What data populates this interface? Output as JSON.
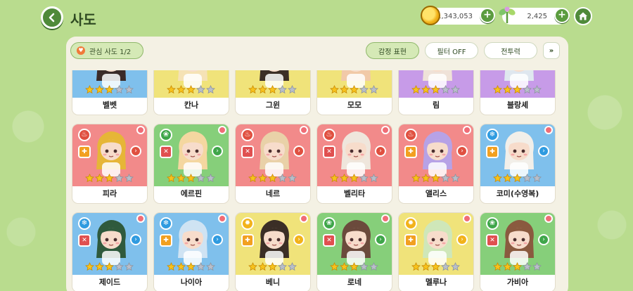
{
  "header": {
    "title": "사도",
    "gold": "1,343,053",
    "leaf": "2,425"
  },
  "filters": {
    "favorites": "관심 사도  1/2",
    "emotion": "감정 표현",
    "filter": "필터 OFF",
    "power": "전투력",
    "more": "»"
  },
  "colors": {
    "accent_green": "#5b9c3f",
    "bg_green": "#b9dc8e",
    "panel": "#f4f1e4"
  },
  "cards": [
    {
      "name": "벨벳",
      "bg": "#7fc0ec",
      "element": "water",
      "elemColor": "#2f9be0",
      "role": "shield",
      "roleColor": "#2f9be0",
      "stars": 3,
      "hair": "#3a2a28",
      "skin": "#f7dccb"
    },
    {
      "name": "칸나",
      "bg": "#f0e37a",
      "element": "light",
      "elemColor": "#f2b21a",
      "role": "sword",
      "roleColor": "#e05050",
      "stars": 3,
      "hair": "#f5e2b5",
      "skin": "#f7dccb"
    },
    {
      "name": "그윈",
      "bg": "#f0e37a",
      "element": "light",
      "elemColor": "#f2b21a",
      "role": "plus",
      "roleColor": "#f2a020",
      "stars": 3,
      "hair": "#3b2e26",
      "skin": "#f7dccb"
    },
    {
      "name": "모모",
      "bg": "#f0e37a",
      "element": "light",
      "elemColor": "#f2b21a",
      "role": "sword",
      "roleColor": "#e05050",
      "stars": 3,
      "hair": "#f1c9a8",
      "skin": "#f7dccb"
    },
    {
      "name": "림",
      "bg": "#c79be8",
      "element": "dark",
      "elemColor": "#8d50d0",
      "role": "sword",
      "roleColor": "#e05050",
      "stars": 3,
      "hair": "#efe2d8",
      "skin": "#f7dccb"
    },
    {
      "name": "블랑셰",
      "bg": "#c79be8",
      "element": "dark",
      "elemColor": "#8d50d0",
      "role": "plus",
      "roleColor": "#f2a020",
      "stars": 3,
      "hair": "#dfe7ef",
      "skin": "#f7dccb"
    },
    {
      "name": "피라",
      "bg": "#f28a8a",
      "element": "fire",
      "elemColor": "#e05040",
      "role": "plus",
      "roleColor": "#f2a020",
      "stars": 3,
      "hair": "#e6b637",
      "skin": "#f7dccb"
    },
    {
      "name": "에르핀",
      "bg": "#86cf7a",
      "element": "wind",
      "elemColor": "#3fa64a",
      "role": "sword",
      "roleColor": "#e05050",
      "stars": 3,
      "hair": "#f4d7a0",
      "skin": "#f7dccb"
    },
    {
      "name": "네르",
      "bg": "#f28a8a",
      "element": "fire",
      "elemColor": "#e05040",
      "role": "sword",
      "roleColor": "#e05050",
      "stars": 3,
      "hair": "#e9d1a8",
      "skin": "#f7dccb"
    },
    {
      "name": "벨리타",
      "bg": "#f28a8a",
      "element": "fire",
      "elemColor": "#e05040",
      "role": "sword",
      "roleColor": "#e05050",
      "stars": 3,
      "hair": "#efe6dc",
      "skin": "#f7dccb"
    },
    {
      "name": "앨리스",
      "bg": "#f28a8a",
      "element": "fire",
      "elemColor": "#e05040",
      "role": "plus",
      "roleColor": "#f2a020",
      "stars": 3,
      "hair": "#b7a2e6",
      "skin": "#f7dccb"
    },
    {
      "name": "코미(수영복)",
      "bg": "#7fc0ec",
      "element": "water",
      "elemColor": "#2f9be0",
      "role": "plus",
      "roleColor": "#f2a020",
      "stars": 3,
      "hair": "#f2efe9",
      "skin": "#f7dccb"
    },
    {
      "name": "제이드",
      "bg": "#7fc0ec",
      "element": "water",
      "elemColor": "#2f9be0",
      "role": "sword",
      "roleColor": "#e05050",
      "stars": 3,
      "hair": "#2f5a3d",
      "skin": "#f7dccb"
    },
    {
      "name": "나이아",
      "bg": "#7fc0ec",
      "element": "water",
      "elemColor": "#2f9be0",
      "role": "plus",
      "roleColor": "#f2a020",
      "stars": 3,
      "hair": "#cfe3f3",
      "skin": "#f7dccb"
    },
    {
      "name": "베니",
      "bg": "#f0e37a",
      "element": "light",
      "elemColor": "#f2b21a",
      "role": "plus",
      "roleColor": "#f2a020",
      "stars": 3,
      "hair": "#3b2e26",
      "skin": "#f7dccb"
    },
    {
      "name": "로네",
      "bg": "#86cf7a",
      "element": "wind",
      "elemColor": "#3fa64a",
      "role": "sword",
      "roleColor": "#e05050",
      "stars": 3,
      "hair": "#6b4a3c",
      "skin": "#f7dccb"
    },
    {
      "name": "멜루나",
      "bg": "#f0e37a",
      "element": "light",
      "elemColor": "#f2b21a",
      "role": "plus",
      "roleColor": "#f2a020",
      "stars": 3,
      "hair": "#cfe7b9",
      "skin": "#f7dccb"
    },
    {
      "name": "가비아",
      "bg": "#86cf7a",
      "element": "wind",
      "elemColor": "#3fa64a",
      "role": "sword",
      "roleColor": "#e05050",
      "stars": 3,
      "hair": "#8a5a3f",
      "skin": "#f7dccb"
    }
  ]
}
